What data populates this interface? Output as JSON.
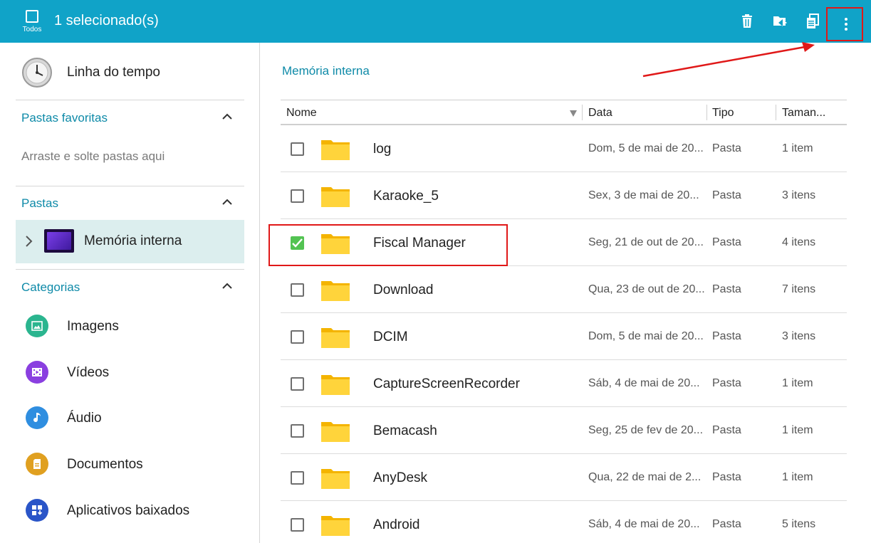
{
  "topbar": {
    "select_all_label": "Todos",
    "title": "1 selecionado(s)",
    "icons": [
      "delete-icon",
      "move-to-folder-icon",
      "copy-icon",
      "more-options-icon"
    ],
    "accent_color": "#10a3c8"
  },
  "sidebar": {
    "timeline_label": "Linha do tempo",
    "favorites": {
      "heading": "Pastas favoritas",
      "hint": "Arraste e solte pastas aqui"
    },
    "folders": {
      "heading": "Pastas",
      "item": "Memória interna"
    },
    "categories": {
      "heading": "Categorias",
      "items": [
        {
          "label": "Imagens",
          "icon": "images-icon",
          "color": "#2bb58f"
        },
        {
          "label": "Vídeos",
          "icon": "videos-icon",
          "color": "#8a3fe0"
        },
        {
          "label": "Áudio",
          "icon": "audio-icon",
          "color": "#2f8ee0"
        },
        {
          "label": "Documentos",
          "icon": "documents-icon",
          "color": "#e0a020"
        },
        {
          "label": "Aplicativos baixados",
          "icon": "downloaded-apps-icon",
          "color": "#2a55c8"
        }
      ]
    }
  },
  "main": {
    "breadcrumb": "Memória interna",
    "columns": {
      "name": "Nome",
      "date": "Data",
      "type": "Tipo",
      "size": "Taman..."
    },
    "rows": [
      {
        "name": "log",
        "date": "Dom, 5 de mai de 20...",
        "type": "Pasta",
        "size": "1 item",
        "checked": false
      },
      {
        "name": "Karaoke_5",
        "date": "Sex, 3 de mai de 20...",
        "type": "Pasta",
        "size": "3 itens",
        "checked": false
      },
      {
        "name": "Fiscal Manager",
        "date": "Seg, 21 de out de 20...",
        "type": "Pasta",
        "size": "4 itens",
        "checked": true
      },
      {
        "name": "Download",
        "date": "Qua, 23 de out de 20...",
        "type": "Pasta",
        "size": "7 itens",
        "checked": false
      },
      {
        "name": "DCIM",
        "date": "Dom, 5 de mai de 20...",
        "type": "Pasta",
        "size": "3 itens",
        "checked": false
      },
      {
        "name": "CaptureScreenRecorder",
        "date": "Sáb, 4 de mai de 20...",
        "type": "Pasta",
        "size": "1 item",
        "checked": false
      },
      {
        "name": "Bemacash",
        "date": "Seg, 25 de fev de 20...",
        "type": "Pasta",
        "size": "1 item",
        "checked": false
      },
      {
        "name": "AnyDesk",
        "date": "Qua, 22 de mai de 2...",
        "type": "Pasta",
        "size": "1 item",
        "checked": false
      },
      {
        "name": "Android",
        "date": "Sáb, 4 de mai de 20...",
        "type": "Pasta",
        "size": "5 itens",
        "checked": false
      }
    ]
  }
}
